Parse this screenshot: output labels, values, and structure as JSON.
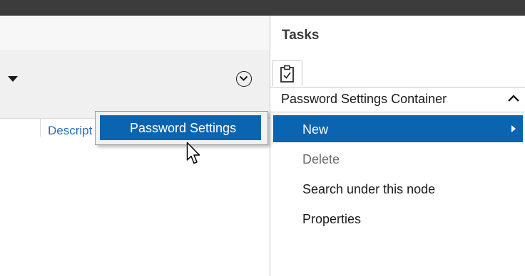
{
  "left_pane": {
    "column_header": "Descript"
  },
  "tasks": {
    "title": "Tasks",
    "section_title": "Password Settings Container",
    "items": [
      {
        "label": "New",
        "state": "selected"
      },
      {
        "label": "Delete",
        "state": "disabled"
      },
      {
        "label": "Search under this node",
        "state": "enabled"
      },
      {
        "label": "Properties",
        "state": "enabled"
      }
    ]
  },
  "submenu": {
    "items": [
      {
        "label": "Password Settings"
      }
    ]
  },
  "colors": {
    "selection": "#0a64b0",
    "link": "#2a6cb8",
    "titlebar": "#3c3c3c"
  },
  "icons": [
    "dropdown-arrow-icon",
    "expand-chevron-icon",
    "clipboard-icon",
    "chevron-up-icon",
    "submenu-arrow-icon",
    "mouse-cursor-icon"
  ]
}
